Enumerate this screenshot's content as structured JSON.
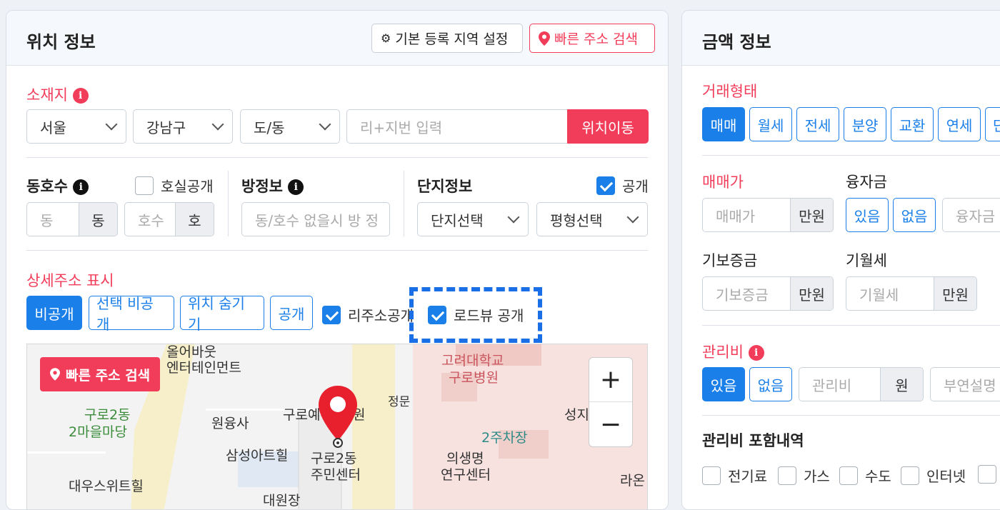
{
  "location": {
    "title": "위치 정보",
    "btn_default_region": "기본 등록 지역 설정",
    "btn_quick_search": "빠른 주소 검색",
    "address_label": "소재지",
    "city": "서울",
    "district": "강남구",
    "dong": "도/동",
    "lot_placeholder": "리+지번 입력",
    "move_button": "위치이동",
    "dongho_label": "동호수",
    "room_public": "호실공개",
    "dong_placeholder": "동",
    "dong_unit": "동",
    "ho_placeholder": "호수",
    "ho_unit": "호",
    "room_info_label": "방정보",
    "room_info_placeholder": "동/호수 없을시 방 정",
    "complex_label": "단지정보",
    "complex_public": "공개",
    "complex_select": "단지선택",
    "size_select": "평형선택",
    "detail_label": "상세주소 표시",
    "detail_options": [
      "비공개",
      "선택 비공개",
      "위치 숨기기",
      "공개"
    ],
    "ri_public": "리주소공개",
    "roadview_public": "로드뷰 공개"
  },
  "map": {
    "quick_search": "빠른 주소 검색",
    "zoom_in": "+",
    "zoom_out": "−",
    "labels": [
      "올어바웃",
      "엔터테인먼트",
      "구로2동",
      "2마을마당",
      "원융사",
      "구로예",
      "원",
      "정문",
      "고려대학교",
      "구로병원",
      "2주차장",
      "성지",
      "삼성아트힐",
      "구로2동",
      "주민센터",
      "의생명",
      "연구센터",
      "대우스위트힐",
      "라온",
      "대원장"
    ]
  },
  "price": {
    "title": "금액 정보",
    "deal_type_label": "거래형태",
    "deal_types": [
      "매매",
      "월세",
      "전세",
      "분양",
      "교환",
      "연세",
      "단"
    ],
    "sale_price_label": "매매가",
    "sale_price_placeholder": "매매가",
    "unit_manwon": "만원",
    "loan_label": "융자금",
    "loan_yes": "있음",
    "loan_no": "없음",
    "loan_placeholder": "융자금",
    "deposit_label": "기보증금",
    "deposit_placeholder": "기보증금",
    "monthly_label": "기월세",
    "monthly_placeholder": "기월세",
    "mgmt_label": "관리비",
    "mgmt_yes": "있음",
    "mgmt_no": "없음",
    "mgmt_placeholder": "관리비",
    "mgmt_unit": "원",
    "mgmt_note_placeholder": "부연설명",
    "included_label": "관리비 포함내역",
    "included_items": [
      "전기료",
      "가스",
      "수도",
      "인터넷"
    ]
  }
}
